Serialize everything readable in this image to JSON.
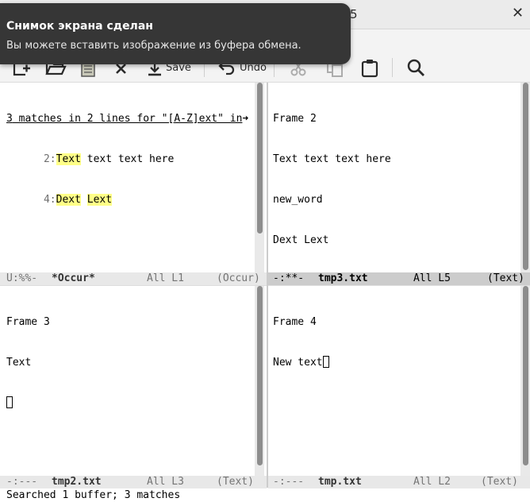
{
  "window": {
    "title_fragment": "5",
    "close_glyph": "✕"
  },
  "notification": {
    "title": "Снимок экрана сделан",
    "body": "Вы можете вставить изображение из буфера обмена."
  },
  "toolbar": {
    "save_label": "Save",
    "undo_label": "Undo"
  },
  "windows": {
    "occur": {
      "header_cursor": "3",
      "header_rest": " matches in 2 lines for \"[A-Z]ext\" in",
      "header_arrow": "➜",
      "results": [
        {
          "num": "2:",
          "match": "Text",
          "rest": " text text here"
        },
        {
          "num": "4:",
          "match": "Dext",
          "sep": " ",
          "match2": "Lext"
        }
      ],
      "modeline": {
        "state": "U:%%-",
        "buffer": "*Occur*",
        "position": "All L1",
        "mode": "(Occur)"
      }
    },
    "tmp3": {
      "lines": [
        "Frame 2",
        "Text text text here",
        "new_word",
        "Dext Lext"
      ],
      "modeline": {
        "state": "-:**-",
        "buffer": "tmp3.txt",
        "position": "All L5",
        "mode": "(Text)"
      }
    },
    "tmp2": {
      "lines": [
        "Frame 3",
        "Text"
      ],
      "modeline": {
        "state": "-:---",
        "buffer": "tmp2.txt",
        "position": "All L3",
        "mode": "(Text)"
      }
    },
    "tmp": {
      "lines": [
        "Frame 4",
        "New text"
      ],
      "modeline": {
        "state": "-:---",
        "buffer": "tmp.txt",
        "position": "All L2",
        "mode": "(Text)"
      }
    }
  },
  "echo_area": "Searched 1 buffer; 3 matches",
  "icons": [
    "new-file-icon",
    "open-folder-icon",
    "save-buffer-icon",
    "close-icon",
    "save-icon",
    "undo-icon",
    "cut-icon",
    "copy-icon",
    "paste-icon",
    "search-icon"
  ],
  "colors": {
    "match_highlight": "#ffff87",
    "notification_bg": "#363636",
    "modeline_active": "#cccccc",
    "modeline_inactive": "#e8e8e8"
  }
}
